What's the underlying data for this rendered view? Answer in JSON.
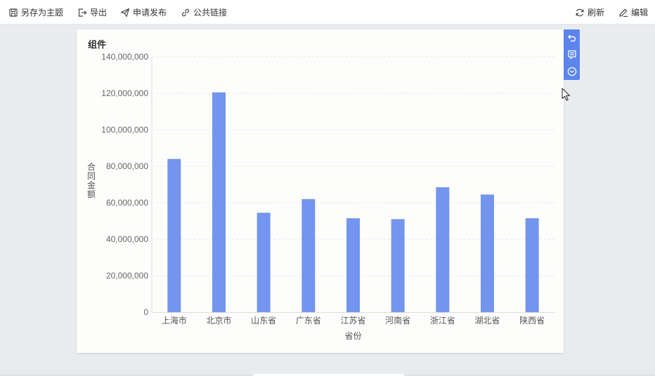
{
  "toolbar": {
    "save_as_theme": "另存为主题",
    "export": "导出",
    "apply_publish": "申请发布",
    "public_link": "公共链接",
    "refresh": "刷新",
    "edit": "编辑"
  },
  "card": {
    "title": "组件"
  },
  "icons": {
    "save_as_theme": "save-theme-icon",
    "export": "export-icon",
    "apply_publish": "send-icon",
    "public_link": "link-icon",
    "refresh": "refresh-icon",
    "edit": "edit-icon",
    "undo": "undo-icon",
    "comment": "comment-icon",
    "more": "chevron-circle-icon"
  },
  "colors": {
    "bar": "#7395ee",
    "accent": "#5b84ec"
  },
  "chart_data": {
    "type": "bar",
    "categories": [
      "上海市",
      "北京市",
      "山东省",
      "广东省",
      "江苏省",
      "河南省",
      "浙江省",
      "湖北省",
      "陕西省"
    ],
    "values": [
      84000000,
      120500000,
      54500000,
      62000000,
      51500000,
      51000000,
      68500000,
      64500000,
      51500000
    ],
    "xlabel": "省份",
    "ylabel": "合同金额",
    "ylim": [
      0,
      140000000
    ],
    "yticks": [
      "0",
      "20,000,000",
      "40,000,000",
      "60,000,000",
      "80,000,000",
      "100,000,000",
      "120,000,000",
      "140,000,000"
    ],
    "grid": true
  }
}
